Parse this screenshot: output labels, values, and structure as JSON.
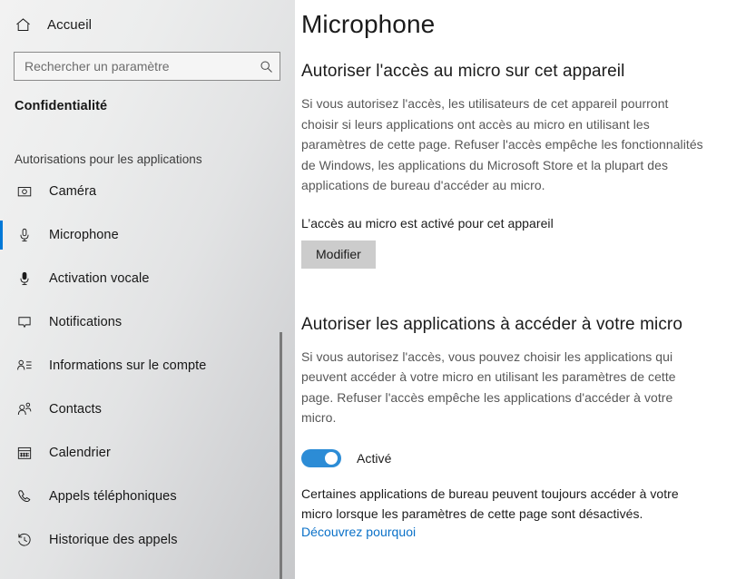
{
  "sidebar": {
    "home": {
      "label": "Accueil",
      "icon": "home-icon"
    },
    "search": {
      "placeholder": "Rechercher un paramètre",
      "value": "",
      "icon": "search-icon"
    },
    "section_title": "Confidentialité",
    "group_label": "Autorisations pour les applications",
    "items": [
      {
        "label": "Caméra",
        "icon": "camera-icon",
        "selected": false
      },
      {
        "label": "Microphone",
        "icon": "microphone-icon",
        "selected": true
      },
      {
        "label": "Activation vocale",
        "icon": "voice-activation-icon",
        "selected": false
      },
      {
        "label": "Notifications",
        "icon": "notification-icon",
        "selected": false
      },
      {
        "label": "Informations sur le compte",
        "icon": "account-info-icon",
        "selected": false
      },
      {
        "label": "Contacts",
        "icon": "contacts-icon",
        "selected": false
      },
      {
        "label": "Calendrier",
        "icon": "calendar-icon",
        "selected": false
      },
      {
        "label": "Appels téléphoniques",
        "icon": "phone-icon",
        "selected": false
      },
      {
        "label": "Historique des appels",
        "icon": "call-history-icon",
        "selected": false
      }
    ]
  },
  "main": {
    "page_title": "Microphone",
    "section1": {
      "heading": "Autoriser l'accès au micro sur cet appareil",
      "body": "Si vous autorisez l'accès, les utilisateurs de cet appareil pourront choisir si leurs applications ont accès au micro en utilisant les paramètres de cette page. Refuser l'accès empêche les fonctionnalités de Windows, les applications du Microsoft Store et la plupart des applications de bureau d'accéder au micro.",
      "status": "L’accès au micro est activé pour cet appareil",
      "button": "Modifier"
    },
    "section2": {
      "heading": "Autoriser les applications à accéder à votre micro",
      "body": "Si vous autorisez l'accès, vous pouvez choisir les applications qui peuvent accéder à votre micro en utilisant les paramètres de cette page. Refuser l'accès empêche les applications d'accéder à votre micro.",
      "toggle_label": "Activé",
      "toggle_state": "on",
      "footer_text": "Certaines applications de bureau peuvent toujours accéder à votre micro lorsque les paramètres de cette page sont désactivés.",
      "footer_link": "Découvrez pourquoi"
    }
  },
  "colors": {
    "accent": "#0078d7",
    "toggle_on": "#2c8cd6",
    "link": "#0a71c8",
    "button_bg": "#cccccc",
    "scrollbar_thumb": "#7a7a7a"
  }
}
